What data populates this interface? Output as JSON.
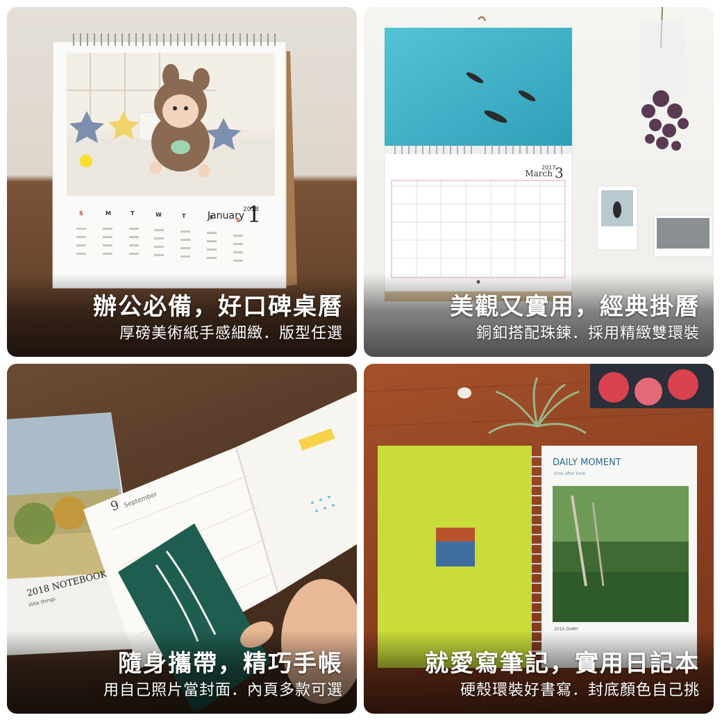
{
  "panels": [
    {
      "headline": "辦公必備，好口碑桌曆",
      "subline": "厚磅美術紙手感細緻．版型任選",
      "product": {
        "year": "2018",
        "month": "January",
        "day": "1",
        "weekday_initials": [
          "S",
          "M",
          "T",
          "W",
          "T",
          "F",
          "S"
        ]
      }
    },
    {
      "headline": "美觀又實用，經典掛曆",
      "subline": "銅釦搭配珠鍊．採用精緻雙環裝",
      "product": {
        "year": "2017",
        "month": "March",
        "day": "3"
      }
    },
    {
      "headline": "隨身攜帶，精巧手帳",
      "subline": "用自己照片當封面．內頁多款可選",
      "product": {
        "cover_title": "2018 NOTEBOOK",
        "cover_subtitle": "little things",
        "page_day": "9",
        "page_month": "September"
      }
    },
    {
      "headline": "就愛寫筆記，實用日記本",
      "subline": "硬殼環裝好書寫．封底顏色自己挑",
      "product": {
        "title": "DAILY MOMENT",
        "tagline": "time after time",
        "footer": "2016 DIARY"
      }
    }
  ]
}
